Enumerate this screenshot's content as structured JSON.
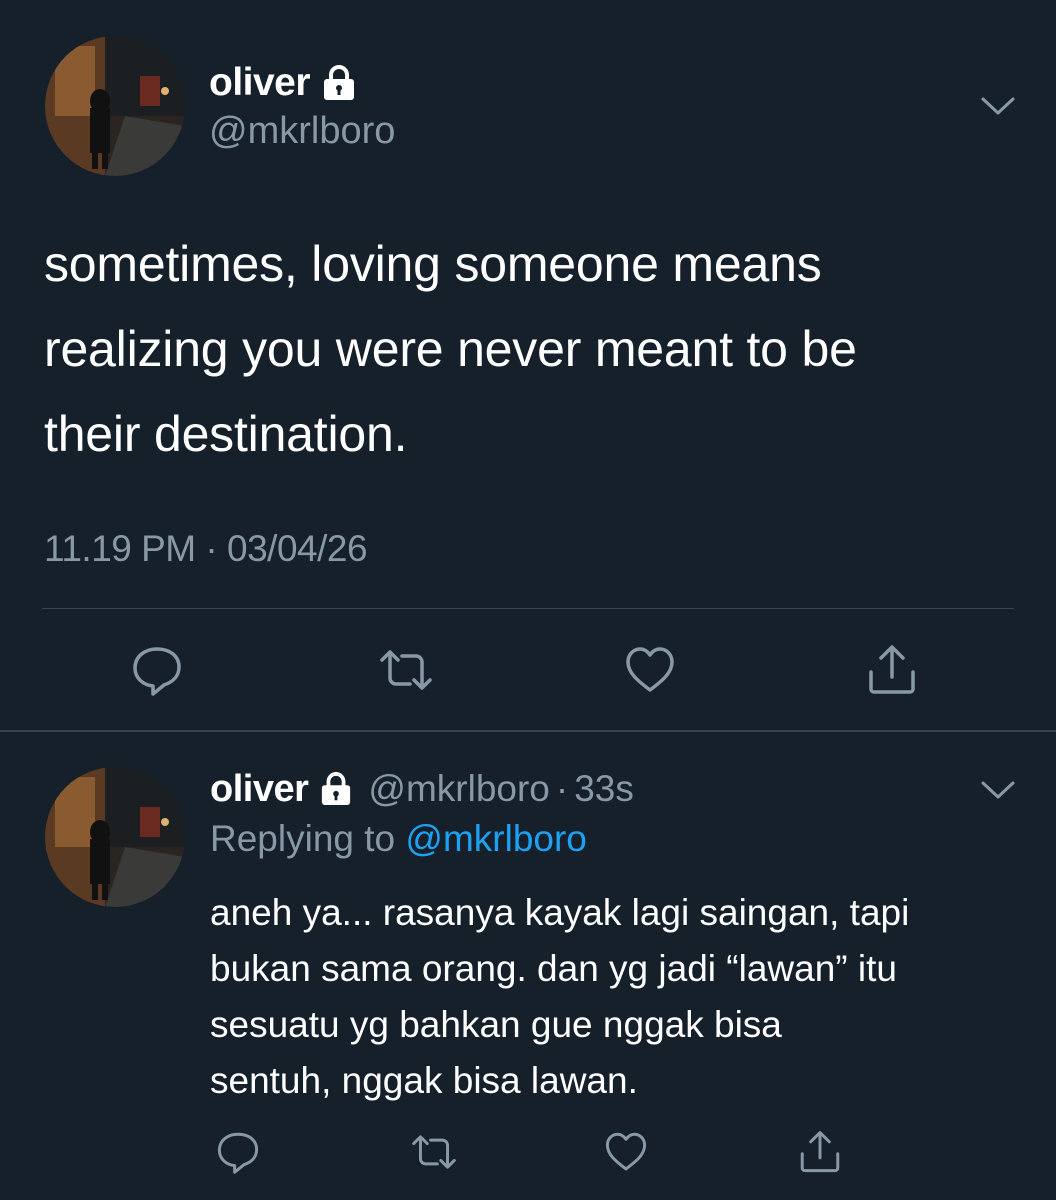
{
  "main_tweet": {
    "display_name": "oliver",
    "handle": "@mkrlboro",
    "text_lines": [
      "sometimes, loving someone means",
      "realizing you were never meant to be",
      "their destination."
    ],
    "timestamp": "11.19 PM · 03/04/26",
    "actions": [
      "reply-icon",
      "retweet-icon",
      "like-icon",
      "share-icon"
    ]
  },
  "reply_tweet": {
    "display_name": "oliver",
    "handle": "@mkrlboro",
    "separator": "·",
    "time_ago": "33s",
    "replying_prefix": "Replying to ",
    "replying_to": "@mkrlboro",
    "text_lines": [
      "aneh ya... rasanya kayak lagi saingan, tapi",
      "bukan sama orang. dan yg jadi “lawan” itu",
      "sesuatu yg bahkan gue nggak bisa",
      "sentuh, nggak bisa lawan."
    ],
    "actions": [
      "reply-icon",
      "retweet-icon",
      "like-icon",
      "share-icon"
    ]
  },
  "colors": {
    "background": "#15202b",
    "text_primary": "#ffffff",
    "text_secondary": "#8899a6",
    "link": "#1da1f2",
    "divider": "#38444d"
  }
}
